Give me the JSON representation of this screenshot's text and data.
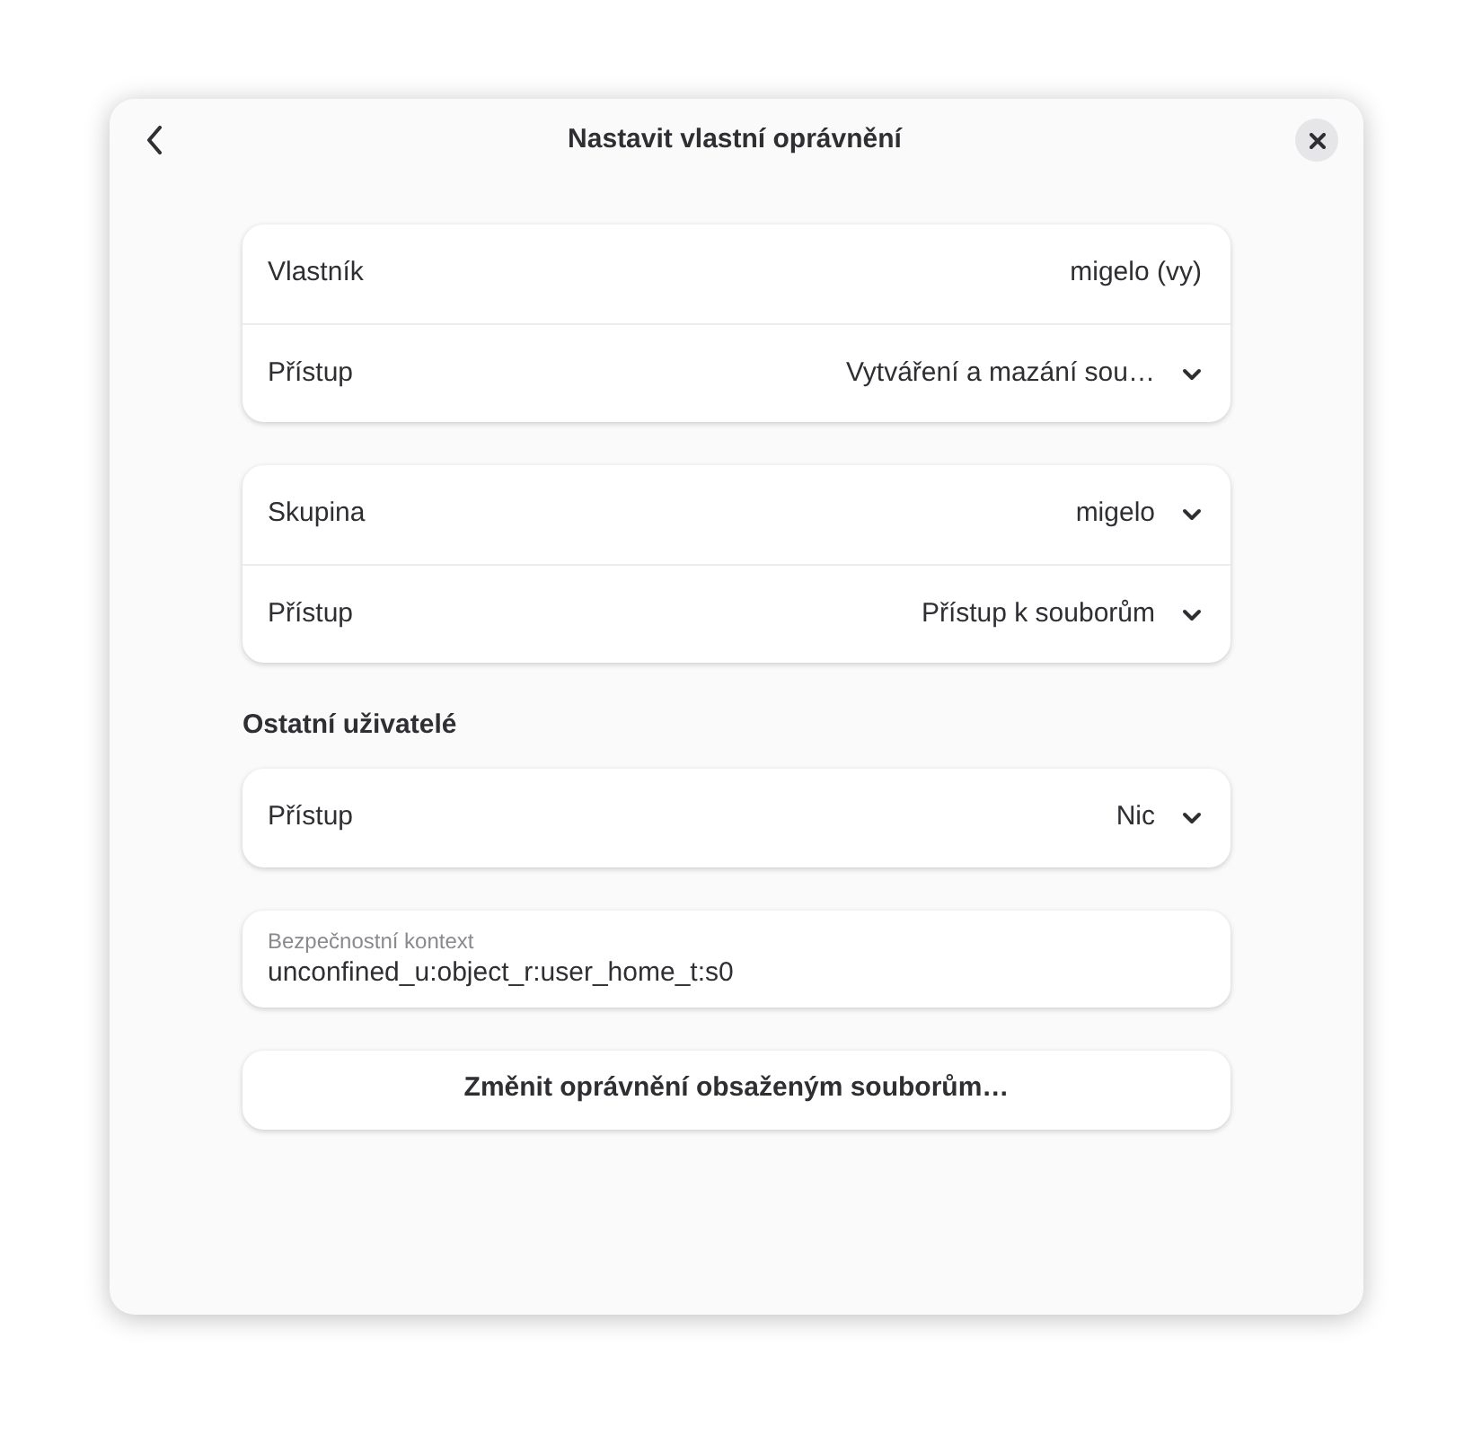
{
  "window": {
    "title": "Nastavit vlastní oprávnění"
  },
  "groups": [
    {
      "rows": [
        {
          "kind": "value",
          "label": "Vlastník",
          "value": "migelo (vy)"
        },
        {
          "kind": "dropdown",
          "label": "Přístup",
          "value": "Vytváření a mazání sou…"
        }
      ]
    },
    {
      "rows": [
        {
          "kind": "dropdown",
          "label": "Skupina",
          "value": "migelo"
        },
        {
          "kind": "dropdown",
          "label": "Přístup",
          "value": "Přístup k souborům"
        }
      ]
    },
    {
      "heading": "Ostatní uživatelé",
      "rows": [
        {
          "kind": "dropdown",
          "label": "Přístup",
          "value": "Nic"
        }
      ]
    }
  ],
  "security_context": {
    "label": "Bezpečnostní kontext",
    "value": "unconfined_u:object_r:user_home_t:s0"
  },
  "apply_button": {
    "label": "Změnit oprávnění obsaženým souborům…"
  }
}
